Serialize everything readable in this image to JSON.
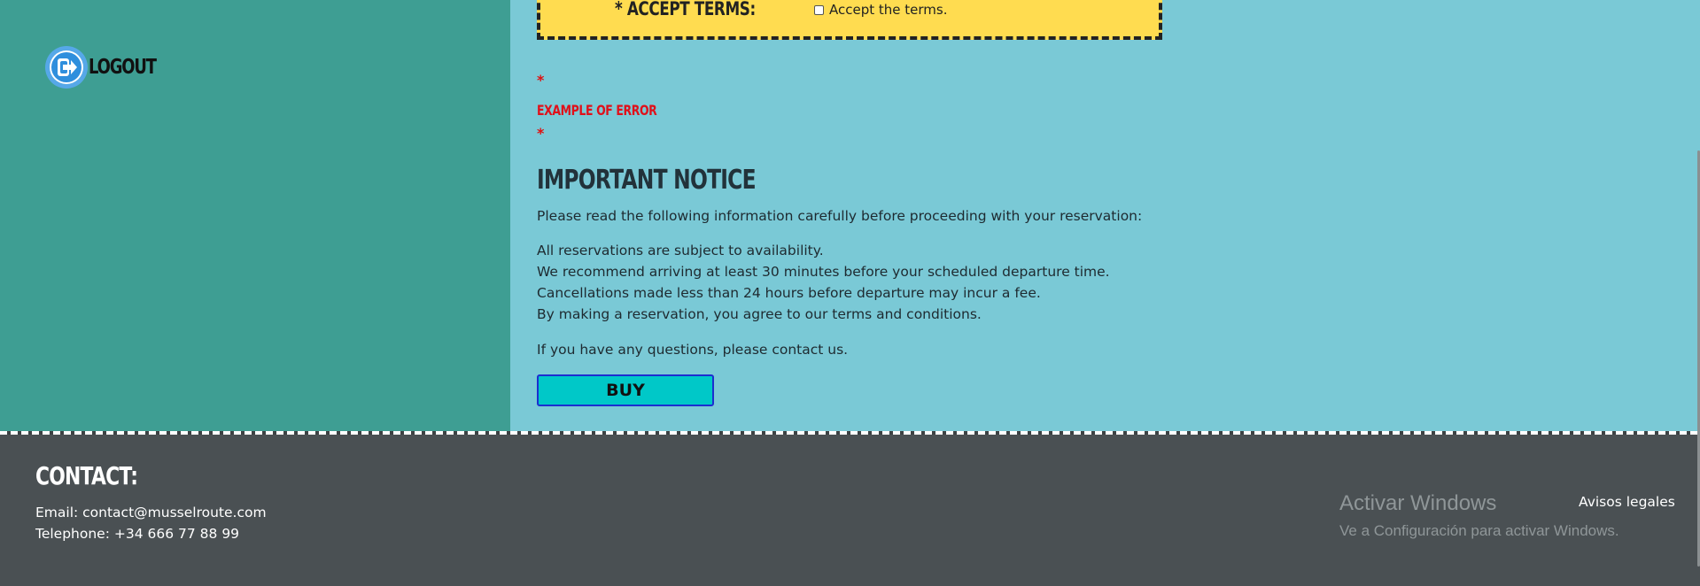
{
  "sidebar": {
    "logout_label": "LOGOUT",
    "logout_icon": "logout-icon"
  },
  "form": {
    "accept_terms_label": "* ACCEPT TERMS:",
    "accept_terms_checkbox_label": "Accept the terms.",
    "accept_terms_checked": false,
    "error_marker_top": "*",
    "error_text": "EXAMPLE OF ERROR",
    "error_marker_bottom": "*"
  },
  "notice": {
    "title": "IMPORTANT NOTICE",
    "intro": "Please read the following information carefully before proceeding with your reservation:",
    "lines": [
      "All reservations are subject to availability.",
      "We recommend arriving at least 30 minutes before your scheduled departure time.",
      "Cancellations made less than 24 hours before departure may incur a fee.",
      "By making a reservation, you agree to our terms and conditions."
    ],
    "outro": "If you have any questions, please contact us."
  },
  "buy_button_label": "BUY",
  "footer": {
    "contact_title": "CONTACT:",
    "email_line": "Email: contact@musselroute.com",
    "telephone_line": "Telephone: +34 666 77 88 99",
    "legal_link": "Avisos legales"
  },
  "windows_watermark": {
    "title": "Activar Windows",
    "subtitle": "Ve a Configuración para activar Windows."
  },
  "colors": {
    "sidebar": "#3e9e93",
    "main": "#7ac9d6",
    "terms_box": "#ffdc50",
    "error": "#e0101a",
    "buy_button": "#00c8c8",
    "footer": "#4a5053"
  }
}
